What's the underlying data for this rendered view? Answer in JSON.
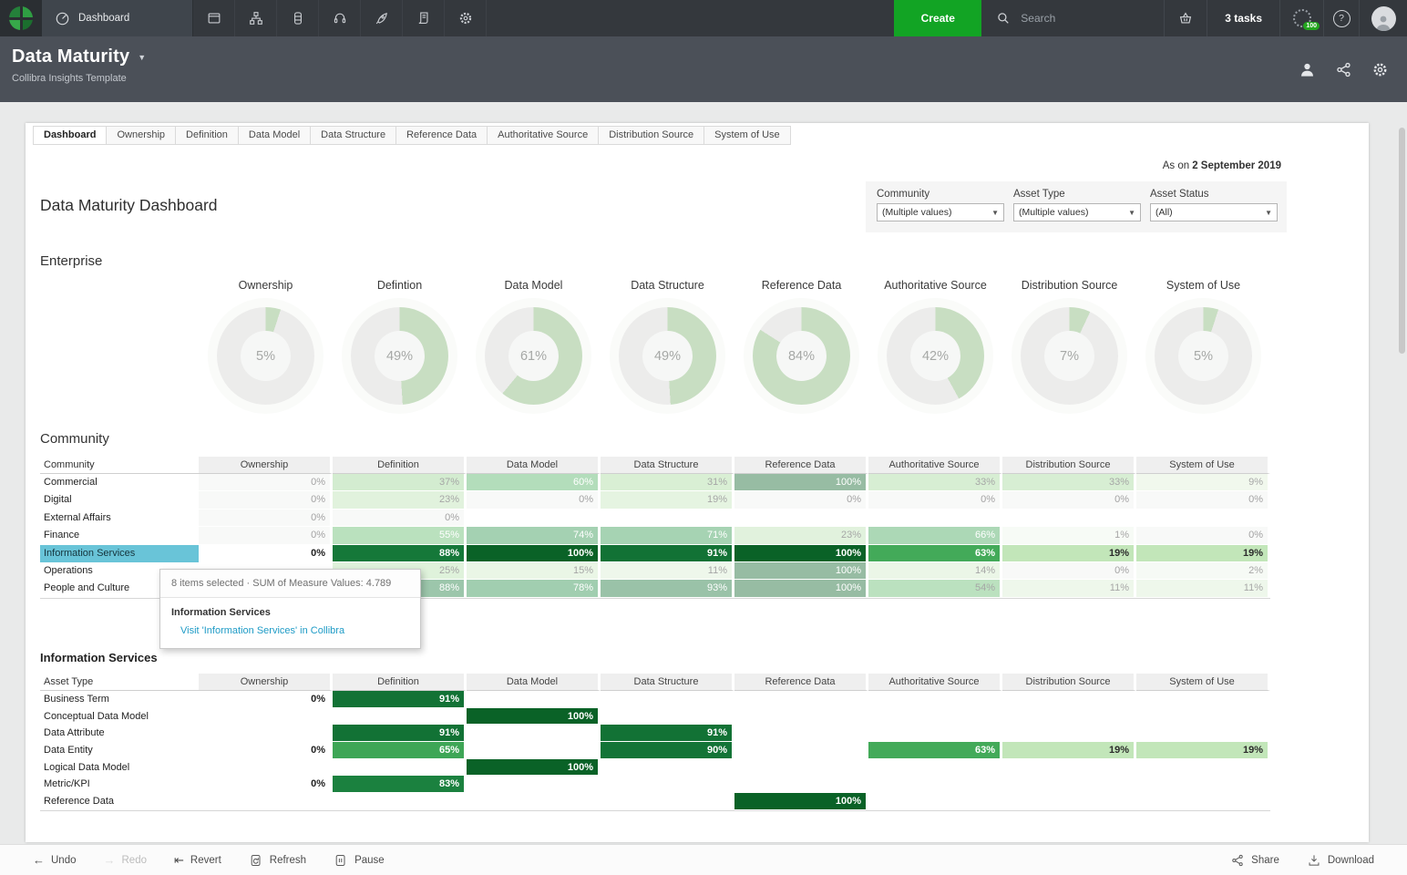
{
  "topbar": {
    "product_tab": {
      "label": "Dashboard",
      "icon": "gauge-icon"
    },
    "nav_icons": [
      "windows-icon",
      "sitemap-icon",
      "database-icon",
      "headset-icon",
      "rocket-icon",
      "scroll-icon",
      "settings-icon"
    ],
    "create_label": "Create",
    "search_placeholder": "Search",
    "tasks_label": "3 tasks",
    "progress_badge": "100",
    "help_glyph": "?"
  },
  "header": {
    "title": "Data Maturity",
    "subtitle": "Collibra Insights Template",
    "icons": [
      "person-icon",
      "share-icon",
      "gear-icon"
    ]
  },
  "report_tabs": [
    "Dashboard",
    "Ownership",
    "Definition",
    "Data Model",
    "Data Structure",
    "Reference Data",
    "Authoritative Source",
    "Distribution Source",
    "System of Use"
  ],
  "active_tab": "Dashboard",
  "as_on": {
    "prefix": "As on",
    "date": "2 September 2019"
  },
  "page_title": "Data Maturity Dashboard",
  "filters": [
    {
      "label": "Community",
      "value": "(Multiple values)"
    },
    {
      "label": "Asset Type",
      "value": "(Multiple values)"
    },
    {
      "label": "Asset Status",
      "value": "(All)"
    }
  ],
  "chart_data": {
    "type": "pie",
    "title": "Enterprise",
    "series": [
      {
        "name": "Ownership",
        "values": [
          5
        ]
      },
      {
        "name": "Defintion",
        "values": [
          49
        ]
      },
      {
        "name": "Data Model",
        "values": [
          61
        ]
      },
      {
        "name": "Data Structure",
        "values": [
          49
        ]
      },
      {
        "name": "Reference Data",
        "values": [
          84
        ]
      },
      {
        "name": "Authoritative Source",
        "values": [
          42
        ]
      },
      {
        "name": "Distribution Source",
        "values": [
          7
        ]
      },
      {
        "name": "System of Use",
        "values": [
          5
        ]
      }
    ]
  },
  "enterprise": {
    "heading": "Enterprise",
    "donuts": [
      {
        "label": "Ownership",
        "pct": 5
      },
      {
        "label": "Defintion",
        "pct": 49
      },
      {
        "label": "Data Model",
        "pct": 61
      },
      {
        "label": "Data Structure",
        "pct": 49
      },
      {
        "label": "Reference Data",
        "pct": 84
      },
      {
        "label": "Authoritative Source",
        "pct": 42
      },
      {
        "label": "Distribution Source",
        "pct": 7
      },
      {
        "label": "System of Use",
        "pct": 5
      }
    ]
  },
  "community": {
    "heading": "Community",
    "columns": [
      "Community",
      "Ownership",
      "Definition",
      "Data Model",
      "Data Structure",
      "Reference Data",
      "Authoritative Source",
      "Distribution Source",
      "System of Use"
    ],
    "rows": [
      {
        "name": "Commercial",
        "values": [
          0,
          37,
          60,
          31,
          100,
          33,
          33,
          9
        ],
        "selected": false
      },
      {
        "name": "Digital",
        "values": [
          0,
          23,
          0,
          19,
          0,
          0,
          0,
          0
        ],
        "selected": false
      },
      {
        "name": "External Affairs",
        "values": [
          0,
          0,
          null,
          null,
          null,
          null,
          null,
          null
        ],
        "selected": false
      },
      {
        "name": "Finance",
        "values": [
          0,
          55,
          74,
          71,
          23,
          66,
          1,
          0
        ],
        "selected": false
      },
      {
        "name": "Information Services",
        "values": [
          0,
          88,
          100,
          91,
          100,
          63,
          19,
          19
        ],
        "selected": true
      },
      {
        "name": "Operations",
        "values": [
          null,
          25,
          15,
          11,
          100,
          14,
          0,
          2
        ],
        "selected": false
      },
      {
        "name": "People and Culture",
        "values": [
          null,
          88,
          78,
          93,
          100,
          54,
          11,
          11
        ],
        "selected": false
      }
    ]
  },
  "tooltip": {
    "summary": "8 items selected  ·  SUM of Measure Values: 4.789",
    "name": "Information Services",
    "link": "Visit 'Information Services' in Collibra"
  },
  "asset": {
    "heading": "Information Services",
    "columns": [
      "Asset Type",
      "Ownership",
      "Definition",
      "Data Model",
      "Data Structure",
      "Reference Data",
      "Authoritative Source",
      "Distribution Source",
      "System of Use"
    ],
    "rows": [
      {
        "name": "Business Term",
        "values": [
          0,
          91,
          null,
          null,
          null,
          null,
          null,
          null
        ]
      },
      {
        "name": "Conceptual Data Model",
        "values": [
          null,
          null,
          100,
          null,
          null,
          null,
          null,
          null
        ]
      },
      {
        "name": "Data Attribute",
        "values": [
          null,
          91,
          null,
          91,
          null,
          null,
          null,
          null
        ]
      },
      {
        "name": "Data Entity",
        "values": [
          0,
          65,
          null,
          90,
          null,
          63,
          19,
          19
        ]
      },
      {
        "name": "Logical Data Model",
        "values": [
          null,
          null,
          100,
          null,
          null,
          null,
          null,
          null
        ]
      },
      {
        "name": "Metric/KPI",
        "values": [
          0,
          83,
          null,
          null,
          null,
          null,
          null,
          null
        ]
      },
      {
        "name": "Reference Data",
        "values": [
          null,
          null,
          null,
          null,
          100,
          null,
          null,
          null
        ]
      }
    ]
  },
  "toolbar": {
    "left": [
      {
        "id": "undo",
        "label": "Undo",
        "icon": "undo-icon",
        "disabled": false
      },
      {
        "id": "redo",
        "label": "Redo",
        "icon": "redo-icon",
        "disabled": true
      },
      {
        "id": "revert",
        "label": "Revert",
        "icon": "revert-icon",
        "disabled": false
      },
      {
        "id": "refresh",
        "label": "Refresh",
        "icon": "refresh-icon",
        "disabled": false
      },
      {
        "id": "pause",
        "label": "Pause",
        "icon": "pause-icon",
        "disabled": false
      }
    ],
    "right": [
      {
        "id": "share",
        "label": "Share",
        "icon": "share-icon",
        "disabled": false
      },
      {
        "id": "download",
        "label": "Download",
        "icon": "download-icon",
        "disabled": false
      }
    ]
  },
  "colors": {
    "accent_green": "#12a424",
    "highlight_teal": "#69c4d8",
    "link_blue": "#1e9bc6",
    "donut_fill": "#c8dec2",
    "donut_track": "#ececeb",
    "scale_low": "#eef6ea",
    "scale_high": "#0a6227"
  }
}
